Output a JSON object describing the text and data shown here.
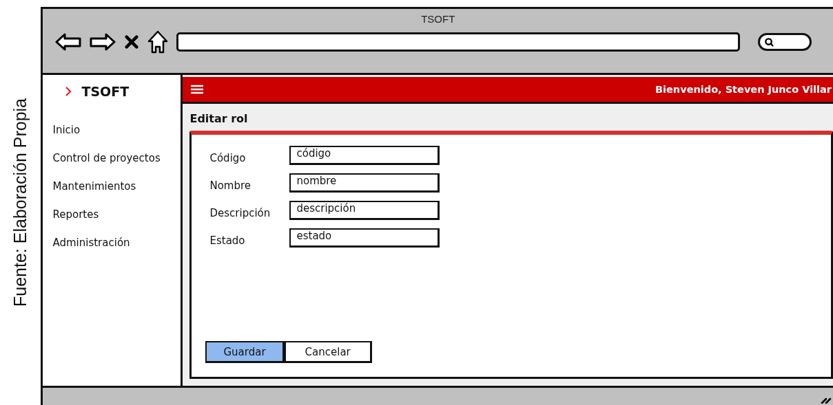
{
  "caption": "Fuente: Elaboración Propia",
  "window": {
    "title": "TSOFT"
  },
  "sidebar": {
    "brand": "TSOFT",
    "items": [
      {
        "label": "Inicio"
      },
      {
        "label": "Control de proyectos"
      },
      {
        "label": "Mantenimientos"
      },
      {
        "label": "Reportes"
      },
      {
        "label": "Administración"
      }
    ]
  },
  "header": {
    "welcome": "Bienvenido, Steven Junco Villar"
  },
  "page": {
    "title": "Editar rol"
  },
  "form": {
    "fields": [
      {
        "label": "Código",
        "value": "código"
      },
      {
        "label": "Nombre",
        "value": "nombre"
      },
      {
        "label": "Descripción",
        "value": "descripción"
      },
      {
        "label": "Estado",
        "value": "estado"
      }
    ]
  },
  "buttons": [
    {
      "label": "Guardar",
      "selected": true
    },
    {
      "label": "Cancelar",
      "selected": false
    }
  ]
}
